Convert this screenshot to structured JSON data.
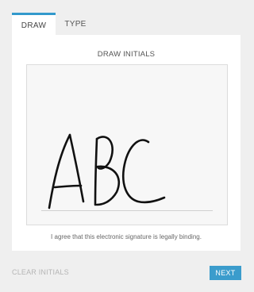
{
  "tabs": {
    "draw_label": "DRAW",
    "type_label": "TYPE",
    "active": "DRAW"
  },
  "panel": {
    "title": "DRAW INITIALS",
    "agreement": "I agree that this electronic signature is legally binding."
  },
  "footer": {
    "clear_label": "CLEAR INITIALS",
    "next_label": "NEXT"
  },
  "colors": {
    "accent": "#3b9ccc",
    "ink": "#111111"
  }
}
